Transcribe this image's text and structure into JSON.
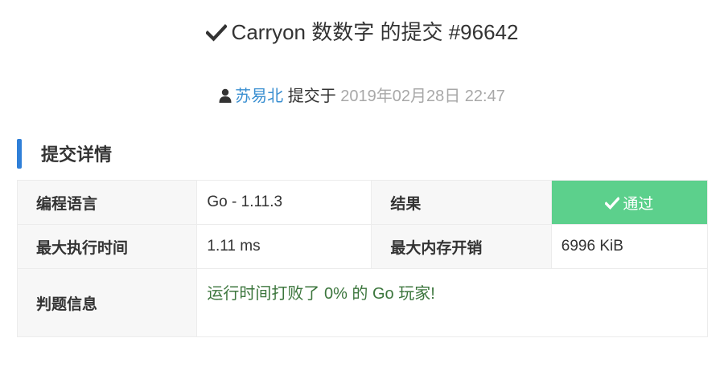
{
  "header": {
    "title": "Carryon 数数字 的提交 #96642",
    "title_icon": "check-icon"
  },
  "submission": {
    "user_icon": "user-icon",
    "user": "苏易北",
    "verb": "提交于",
    "time": "2019年02月28日 22:47"
  },
  "section": {
    "title": "提交详情"
  },
  "details": {
    "language_label": "编程语言",
    "language_value": "Go - 1.11.3",
    "result_label": "结果",
    "result_icon": "check-icon",
    "result_value": "通过",
    "max_time_label": "最大执行时间",
    "max_time_value": "1.11 ms",
    "max_memory_label": "最大内存开销",
    "max_memory_value": "6996 KiB",
    "judge_info_label": "判题信息",
    "judge_info_value": "运行时间打败了 0% 的 Go 玩家!"
  },
  "colors": {
    "accent": "#2f7fd8",
    "link": "#3a8fd1",
    "success_bg": "#5cd08c",
    "success_text": "#3c763d",
    "muted": "#a8a8a8"
  }
}
